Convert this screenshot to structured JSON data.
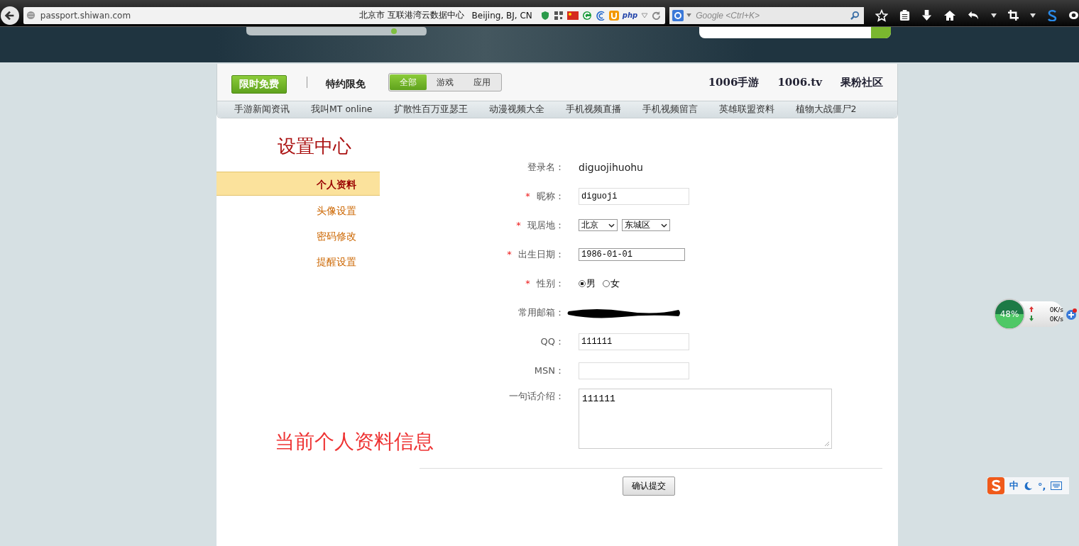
{
  "browser": {
    "url": "passport.shiwan.com",
    "location_cn": "北京市 互联港湾云数据中心",
    "location_en": "Beijing, BJ, CN",
    "addon_text": "php",
    "search": {
      "placeholder": "Google <Ctrl+K>"
    }
  },
  "site_nav": {
    "promo_button": "限时免费",
    "special": "特约限免",
    "filter_tabs": [
      {
        "label": "全部",
        "selected": true
      },
      {
        "label": "游戏",
        "selected": false
      },
      {
        "label": "应用",
        "selected": false
      }
    ],
    "links": [
      "1006手游",
      "1006.tv",
      "果粉社区"
    ],
    "sub_links": [
      "手游新闻资讯",
      "我叫MT online",
      "扩散性百万亚瑟王",
      "动漫视频大全",
      "手机视频直播",
      "手机视频留言",
      "英雄联盟资料",
      "植物大战僵尸2"
    ]
  },
  "settings": {
    "title": "设置中心",
    "menu": [
      {
        "label": "个人资料",
        "selected": true
      },
      {
        "label": "头像设置",
        "selected": false
      },
      {
        "label": "密码修改",
        "selected": false
      },
      {
        "label": "提醒设置",
        "selected": false
      }
    ],
    "annotation": "当前个人资料信息"
  },
  "form": {
    "fields": [
      {
        "kind": "text",
        "label": "登录名：",
        "value": "diguojihuohu"
      },
      {
        "kind": "input",
        "required_mark": "*",
        "label": "昵称：",
        "value": "diguoji"
      },
      {
        "kind": "selects",
        "required_mark": "*",
        "label": "现居地：",
        "options": [
          "北京",
          "东城区"
        ]
      },
      {
        "kind": "date",
        "required_mark": "*",
        "label": "出生日期：",
        "value": "1986-01-01"
      },
      {
        "kind": "radios",
        "required_mark": "*",
        "label": "性别：",
        "options": [
          {
            "label": "男",
            "selected": true
          },
          {
            "label": "女",
            "selected": false
          }
        ]
      },
      {
        "kind": "redacted",
        "label": "常用邮箱："
      },
      {
        "kind": "input",
        "label": "QQ：",
        "value": "111111"
      },
      {
        "kind": "input",
        "label": "MSN："
      },
      {
        "kind": "textarea",
        "label": "一句话介绍：",
        "value": "111111"
      }
    ],
    "submit": "确认提交"
  },
  "widgets": {
    "memory": {
      "text": "48%",
      "upload": "0K/s",
      "download": "0K/s"
    },
    "ime": {
      "mode": "中",
      "punct": "°,"
    }
  }
}
